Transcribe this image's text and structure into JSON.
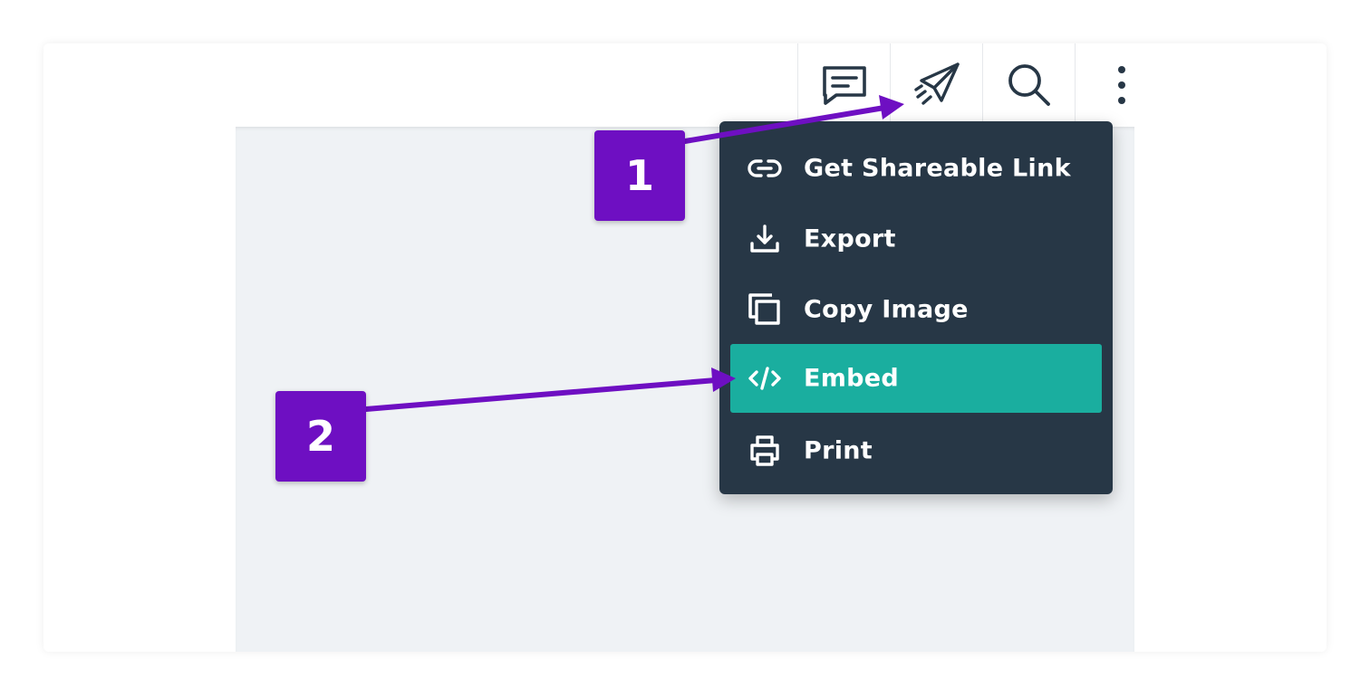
{
  "toolbar": {
    "buttons": [
      {
        "name": "comment",
        "icon": "comment-icon"
      },
      {
        "name": "share",
        "icon": "paper-plane-icon"
      },
      {
        "name": "search",
        "icon": "search-icon"
      },
      {
        "name": "more",
        "icon": "more-vertical-icon"
      }
    ]
  },
  "share_menu": {
    "items": [
      {
        "label": "Get Shareable Link",
        "icon": "link-icon"
      },
      {
        "label": "Export",
        "icon": "download-icon"
      },
      {
        "label": "Copy Image",
        "icon": "copy-icon"
      },
      {
        "label": "Embed",
        "icon": "code-icon",
        "active": true
      },
      {
        "label": "Print",
        "icon": "printer-icon"
      }
    ]
  },
  "annotations": {
    "step1": "1",
    "step2": "2"
  },
  "colors": {
    "menu_background": "#273746",
    "active_item": "#1aae9f",
    "annotation": "#6e0fc2",
    "canvas": "#eff2f5",
    "icon_stroke": "#273746"
  }
}
